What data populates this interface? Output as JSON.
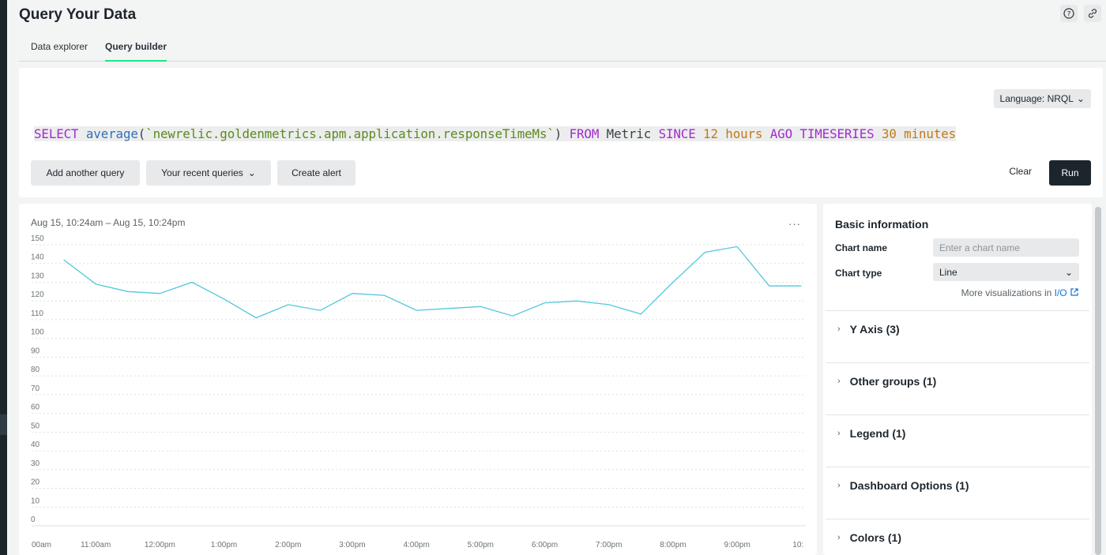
{
  "page": {
    "title": "Query Your Data",
    "help_icon": "help-icon",
    "link_icon": "link-icon"
  },
  "tabs": [
    {
      "label": "Data explorer",
      "active": false
    },
    {
      "label": "Query builder",
      "active": true
    }
  ],
  "query": {
    "language_label": "Language: NRQL",
    "text_parts": [
      {
        "t": "SELECT",
        "c": "kw"
      },
      {
        "t": " ",
        "c": "plain"
      },
      {
        "t": "average",
        "c": "fn"
      },
      {
        "t": "(",
        "c": "plain"
      },
      {
        "t": "`newrelic.goldenmetrics.apm.application.responseTimeMs`",
        "c": "str"
      },
      {
        "t": ") ",
        "c": "plain"
      },
      {
        "t": "FROM",
        "c": "kw"
      },
      {
        "t": " Metric ",
        "c": "plain"
      },
      {
        "t": "SINCE",
        "c": "kw"
      },
      {
        "t": " ",
        "c": "plain"
      },
      {
        "t": "12 hours",
        "c": "num"
      },
      {
        "t": " ",
        "c": "plain"
      },
      {
        "t": "AGO",
        "c": "kw"
      },
      {
        "t": " ",
        "c": "plain"
      },
      {
        "t": "TIMESERIES",
        "c": "kw"
      },
      {
        "t": " ",
        "c": "plain"
      },
      {
        "t": "30 minutes",
        "c": "num"
      }
    ],
    "add_query_label": "Add another query",
    "recent_queries_label": "Your recent queries",
    "create_alert_label": "Create alert",
    "clear_label": "Clear",
    "run_label": "Run"
  },
  "chart_panel": {
    "range_label": "Aug 15, 10:24am – Aug 15, 10:24pm",
    "more_label": "···"
  },
  "chart_data": {
    "type": "line",
    "ylim": [
      0,
      150
    ],
    "yticks": [
      0,
      10,
      20,
      30,
      40,
      50,
      60,
      70,
      80,
      90,
      100,
      110,
      120,
      130,
      140,
      150
    ],
    "xlim": [
      10.0,
      22.07
    ],
    "xticks": [
      {
        "v": 10.0,
        "label": "00am"
      },
      {
        "v": 11.0,
        "label": "11:00am"
      },
      {
        "v": 12.0,
        "label": "12:00pm"
      },
      {
        "v": 13.0,
        "label": "1:00pm"
      },
      {
        "v": 14.0,
        "label": "2:00pm"
      },
      {
        "v": 15.0,
        "label": "3:00pm"
      },
      {
        "v": 16.0,
        "label": "4:00pm"
      },
      {
        "v": 17.0,
        "label": "5:00pm"
      },
      {
        "v": 18.0,
        "label": "6:00pm"
      },
      {
        "v": 19.0,
        "label": "7:00pm"
      },
      {
        "v": 20.0,
        "label": "8:00pm"
      },
      {
        "v": 21.0,
        "label": "9:00pm"
      },
      {
        "v": 21.95,
        "label": "10:"
      }
    ],
    "series": [
      {
        "color": "#52c7dd",
        "x": [
          10.5,
          11.0,
          11.5,
          12.0,
          12.5,
          13.0,
          13.5,
          14.0,
          14.5,
          15.0,
          15.5,
          16.0,
          16.5,
          17.0,
          17.5,
          18.0,
          18.5,
          19.0,
          19.5,
          20.0,
          20.5,
          21.0,
          21.5,
          22.0
        ],
        "values": [
          142,
          129,
          125,
          124,
          130,
          121,
          111,
          118,
          115,
          124,
          123,
          115,
          116,
          117,
          112,
          119,
          120,
          118,
          113,
          130,
          146,
          149,
          128,
          128
        ]
      }
    ]
  },
  "side": {
    "title": "Basic information",
    "chart_name_label": "Chart name",
    "chart_name_placeholder": "Enter a chart name",
    "chart_type_label": "Chart type",
    "chart_type_value": "Line",
    "more_viz_text": "More visualizations in ",
    "more_viz_link": "I/O",
    "sections": [
      {
        "label": "Y Axis (3)"
      },
      {
        "label": "Other groups (1)"
      },
      {
        "label": "Legend (1)"
      },
      {
        "label": "Dashboard Options (1)"
      },
      {
        "label": "Colors (1)"
      }
    ]
  }
}
